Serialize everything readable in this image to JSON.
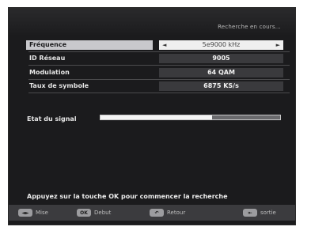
{
  "header": {
    "title": "Recherche en cours..."
  },
  "rows": [
    {
      "label": "Fréquence",
      "value": "5e9000 kHz"
    },
    {
      "label": "ID Réseau",
      "value": "9005"
    },
    {
      "label": "Modulation",
      "value": "64 QAM"
    },
    {
      "label": "Taux de symbole",
      "value": "6875 KS/s"
    }
  ],
  "signal": {
    "label": "Etat du signal",
    "level": 0.62
  },
  "message": "Appuyez sur la touche OK pour commencer la recherche",
  "footer": {
    "buttons": [
      {
        "key": "◄►",
        "label": "Mise"
      },
      {
        "key": "OK",
        "label": "Debut"
      },
      {
        "key": "↶",
        "label": "Retour"
      },
      {
        "key": "⇤",
        "label": "sortie"
      }
    ]
  },
  "colors": {
    "screen_bg": "#1b1b1d",
    "selected_label_bg": "#c8c8cc",
    "selected_value_bg": "#efefef",
    "value_bg": "#3a3a3d",
    "footer_bg": "#3b3b3e"
  }
}
